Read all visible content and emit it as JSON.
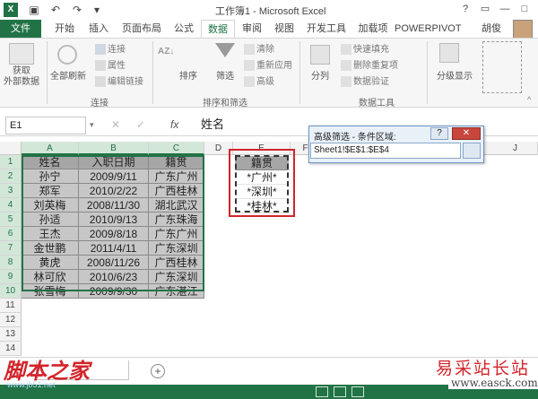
{
  "app": {
    "title": "工作簿1 - Microsoft Excel",
    "user": "胡俊"
  },
  "tabs": [
    "文件",
    "开始",
    "插入",
    "页面布局",
    "公式",
    "数据",
    "审阅",
    "视图",
    "开发工具",
    "加载项",
    "POWERPIVOT"
  ],
  "ribbon": {
    "get_external": "获取\n外部数据",
    "refresh_all": "全部刷新",
    "connections": "连接",
    "properties": "属性",
    "edit_links": "编辑链接",
    "group_connections": "连接",
    "sort_az": "AZ↓",
    "sort": "排序",
    "filter": "筛选",
    "clear": "清除",
    "reapply": "重新应用",
    "advanced": "高级",
    "group_sort_filter": "排序和筛选",
    "text_to_columns": "分列",
    "flash_fill": "快速填充",
    "remove_dup": "删除重复项",
    "data_validation": "数据验证",
    "group_data_tools": "数据工具",
    "outline": "分级显示"
  },
  "formula_bar": {
    "name_box": "E1",
    "fx": "fx",
    "value": "姓名"
  },
  "columns": [
    "A",
    "B",
    "C",
    "D",
    "E",
    "F",
    "J"
  ],
  "rows": [
    "1",
    "2",
    "3",
    "4",
    "5",
    "6",
    "7",
    "8",
    "9",
    "10",
    "11",
    "12",
    "13",
    "14"
  ],
  "table": {
    "headers": [
      "姓名",
      "入职日期",
      "籍贯"
    ],
    "rows": [
      [
        "孙宁",
        "2009/9/11",
        "广东广州"
      ],
      [
        "郑军",
        "2010/2/22",
        "广西桂林"
      ],
      [
        "刘英梅",
        "2008/11/30",
        "湖北武汉"
      ],
      [
        "孙适",
        "2010/9/13",
        "广东珠海"
      ],
      [
        "王杰",
        "2009/8/18",
        "广东广州"
      ],
      [
        "金世鹏",
        "2011/4/11",
        "广东深圳"
      ],
      [
        "黄虎",
        "2008/11/26",
        "广西桂林"
      ],
      [
        "林可欣",
        "2010/6/23",
        "广东深圳"
      ],
      [
        "张雪梅",
        "2009/9/30",
        "广东湛江"
      ]
    ]
  },
  "criteria": {
    "header": "籍贯",
    "values": [
      "*广州*",
      "*深圳*",
      "*桂林*"
    ]
  },
  "dialog": {
    "title": "高级筛选 - 条件区域:",
    "help": "?",
    "close": "✕",
    "value": "Sheet1!$E$1:$E$4"
  },
  "status": {
    "add_sheet": "+"
  },
  "watermarks": {
    "left": "脚本之家",
    "left_sub": "www.jb51.net",
    "right": "易采站长站",
    "right_sub": "www.easck.com"
  },
  "colors": {
    "excel_green": "#217346",
    "highlight_red": "#d3242b"
  }
}
